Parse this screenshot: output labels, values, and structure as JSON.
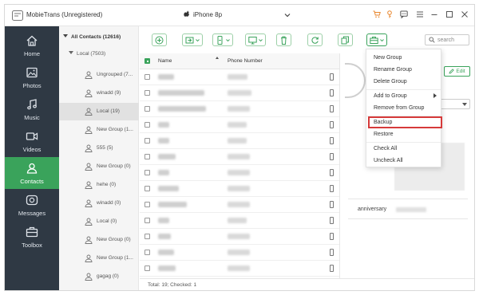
{
  "app": {
    "title": "MobieTrans (Unregistered)",
    "device": "iPhone 8p"
  },
  "nav": {
    "items": [
      {
        "label": "Home",
        "icon": "home-icon",
        "active": false
      },
      {
        "label": "Photos",
        "icon": "photos-icon",
        "active": false
      },
      {
        "label": "Music",
        "icon": "music-icon",
        "active": false
      },
      {
        "label": "Videos",
        "icon": "videos-icon",
        "active": false
      },
      {
        "label": "Contacts",
        "icon": "contacts-icon",
        "active": true
      },
      {
        "label": "Messages",
        "icon": "messages-icon",
        "active": false
      },
      {
        "label": "Toolbox",
        "icon": "toolbox-icon",
        "active": false
      }
    ]
  },
  "groups": {
    "all": "All Contacts  (12616)",
    "local": "Local  (7503)",
    "items": [
      {
        "name": "Ungrouped  (7...",
        "active": false
      },
      {
        "name": "winadd  (9)",
        "active": false
      },
      {
        "name": "Local  (19)",
        "active": true
      },
      {
        "name": "New Group  (1...",
        "active": false
      },
      {
        "name": "555  (5)",
        "active": false
      },
      {
        "name": "New Group  (0)",
        "active": false
      },
      {
        "name": "hehe  (0)",
        "active": false
      },
      {
        "name": "winadd  (0)",
        "active": false
      },
      {
        "name": "Local  (0)",
        "active": false
      },
      {
        "name": "New Group  (0)",
        "active": false
      },
      {
        "name": "New Group  (1...",
        "active": false
      },
      {
        "name": "gagag  (0)",
        "active": false
      }
    ]
  },
  "table": {
    "col_name": "Name",
    "col_phone": "Phone Number",
    "status": "Total: 19; Checked: 1"
  },
  "detail": {
    "edit_label": "Edit",
    "anniversary_label": "anniversary"
  },
  "menu": {
    "items": [
      {
        "label": "New Group"
      },
      {
        "label": "Rename Group"
      },
      {
        "label": "Delete Group"
      },
      {
        "label": "Add to Group",
        "has_submenu": true
      },
      {
        "label": "Remove from Group"
      },
      {
        "label": "Backup",
        "highlighted": true
      },
      {
        "label": "Restore"
      },
      {
        "label": "Check All"
      },
      {
        "label": "Uncheck All"
      }
    ],
    "highlight_color": "#d63a3a"
  },
  "search": {
    "placeholder": "search"
  },
  "colors": {
    "accent": "#3aa35b",
    "nav_bg": "#2f3944"
  }
}
